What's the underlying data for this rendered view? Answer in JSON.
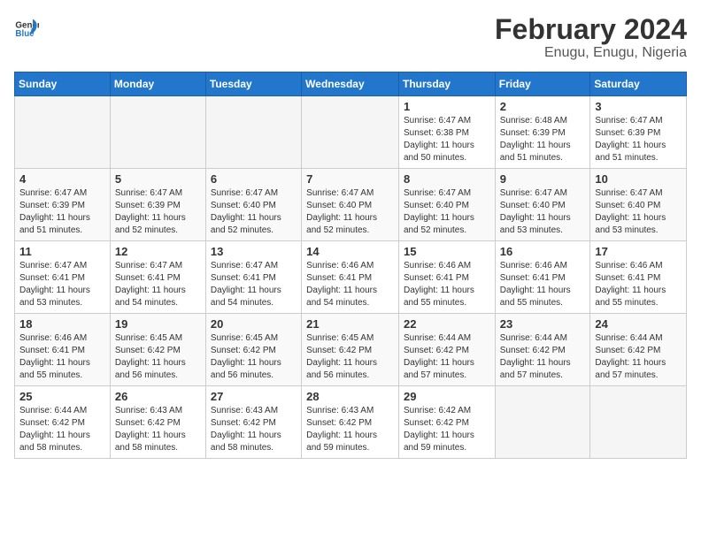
{
  "header": {
    "logo_general": "General",
    "logo_blue": "Blue",
    "title": "February 2024",
    "subtitle": "Enugu, Enugu, Nigeria"
  },
  "weekdays": [
    "Sunday",
    "Monday",
    "Tuesday",
    "Wednesday",
    "Thursday",
    "Friday",
    "Saturday"
  ],
  "weeks": [
    [
      {
        "day": "",
        "info": ""
      },
      {
        "day": "",
        "info": ""
      },
      {
        "day": "",
        "info": ""
      },
      {
        "day": "",
        "info": ""
      },
      {
        "day": "1",
        "info": "Sunrise: 6:47 AM\nSunset: 6:38 PM\nDaylight: 11 hours and 50 minutes."
      },
      {
        "day": "2",
        "info": "Sunrise: 6:48 AM\nSunset: 6:39 PM\nDaylight: 11 hours and 51 minutes."
      },
      {
        "day": "3",
        "info": "Sunrise: 6:47 AM\nSunset: 6:39 PM\nDaylight: 11 hours and 51 minutes."
      }
    ],
    [
      {
        "day": "4",
        "info": "Sunrise: 6:47 AM\nSunset: 6:39 PM\nDaylight: 11 hours and 51 minutes."
      },
      {
        "day": "5",
        "info": "Sunrise: 6:47 AM\nSunset: 6:39 PM\nDaylight: 11 hours and 52 minutes."
      },
      {
        "day": "6",
        "info": "Sunrise: 6:47 AM\nSunset: 6:40 PM\nDaylight: 11 hours and 52 minutes."
      },
      {
        "day": "7",
        "info": "Sunrise: 6:47 AM\nSunset: 6:40 PM\nDaylight: 11 hours and 52 minutes."
      },
      {
        "day": "8",
        "info": "Sunrise: 6:47 AM\nSunset: 6:40 PM\nDaylight: 11 hours and 52 minutes."
      },
      {
        "day": "9",
        "info": "Sunrise: 6:47 AM\nSunset: 6:40 PM\nDaylight: 11 hours and 53 minutes."
      },
      {
        "day": "10",
        "info": "Sunrise: 6:47 AM\nSunset: 6:40 PM\nDaylight: 11 hours and 53 minutes."
      }
    ],
    [
      {
        "day": "11",
        "info": "Sunrise: 6:47 AM\nSunset: 6:41 PM\nDaylight: 11 hours and 53 minutes."
      },
      {
        "day": "12",
        "info": "Sunrise: 6:47 AM\nSunset: 6:41 PM\nDaylight: 11 hours and 54 minutes."
      },
      {
        "day": "13",
        "info": "Sunrise: 6:47 AM\nSunset: 6:41 PM\nDaylight: 11 hours and 54 minutes."
      },
      {
        "day": "14",
        "info": "Sunrise: 6:46 AM\nSunset: 6:41 PM\nDaylight: 11 hours and 54 minutes."
      },
      {
        "day": "15",
        "info": "Sunrise: 6:46 AM\nSunset: 6:41 PM\nDaylight: 11 hours and 55 minutes."
      },
      {
        "day": "16",
        "info": "Sunrise: 6:46 AM\nSunset: 6:41 PM\nDaylight: 11 hours and 55 minutes."
      },
      {
        "day": "17",
        "info": "Sunrise: 6:46 AM\nSunset: 6:41 PM\nDaylight: 11 hours and 55 minutes."
      }
    ],
    [
      {
        "day": "18",
        "info": "Sunrise: 6:46 AM\nSunset: 6:41 PM\nDaylight: 11 hours and 55 minutes."
      },
      {
        "day": "19",
        "info": "Sunrise: 6:45 AM\nSunset: 6:42 PM\nDaylight: 11 hours and 56 minutes."
      },
      {
        "day": "20",
        "info": "Sunrise: 6:45 AM\nSunset: 6:42 PM\nDaylight: 11 hours and 56 minutes."
      },
      {
        "day": "21",
        "info": "Sunrise: 6:45 AM\nSunset: 6:42 PM\nDaylight: 11 hours and 56 minutes."
      },
      {
        "day": "22",
        "info": "Sunrise: 6:44 AM\nSunset: 6:42 PM\nDaylight: 11 hours and 57 minutes."
      },
      {
        "day": "23",
        "info": "Sunrise: 6:44 AM\nSunset: 6:42 PM\nDaylight: 11 hours and 57 minutes."
      },
      {
        "day": "24",
        "info": "Sunrise: 6:44 AM\nSunset: 6:42 PM\nDaylight: 11 hours and 57 minutes."
      }
    ],
    [
      {
        "day": "25",
        "info": "Sunrise: 6:44 AM\nSunset: 6:42 PM\nDaylight: 11 hours and 58 minutes."
      },
      {
        "day": "26",
        "info": "Sunrise: 6:43 AM\nSunset: 6:42 PM\nDaylight: 11 hours and 58 minutes."
      },
      {
        "day": "27",
        "info": "Sunrise: 6:43 AM\nSunset: 6:42 PM\nDaylight: 11 hours and 58 minutes."
      },
      {
        "day": "28",
        "info": "Sunrise: 6:43 AM\nSunset: 6:42 PM\nDaylight: 11 hours and 59 minutes."
      },
      {
        "day": "29",
        "info": "Sunrise: 6:42 AM\nSunset: 6:42 PM\nDaylight: 11 hours and 59 minutes."
      },
      {
        "day": "",
        "info": ""
      },
      {
        "day": "",
        "info": ""
      }
    ]
  ]
}
